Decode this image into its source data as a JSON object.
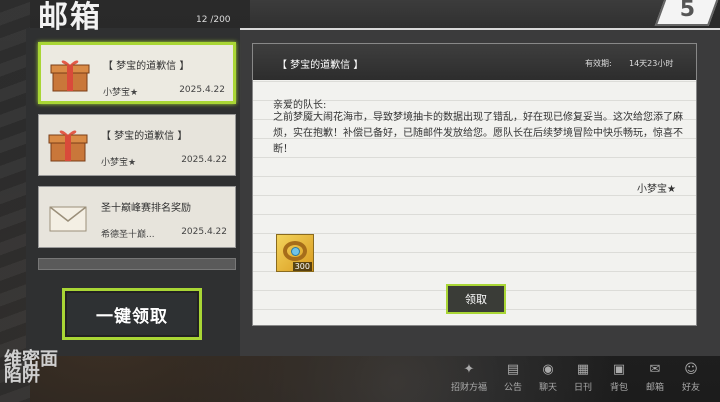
{
  "header": {
    "title": "邮箱",
    "count": "12 /200",
    "close_label": "5"
  },
  "mails": [
    {
      "subject": "【 梦宝的道歉信 】",
      "sender": "小梦宝★",
      "date": "2025.4.22",
      "active": true,
      "icon": "gift-box-icon"
    },
    {
      "subject": "【 梦宝的道歉信 】",
      "sender": "小梦宝★",
      "date": "2025.4.22",
      "active": false,
      "icon": "gift-box-icon"
    },
    {
      "subject": "圣十巅峰赛排名奖励",
      "sender": "希德圣十巅...",
      "date": "2025.4.22",
      "active": false,
      "icon": "envelope-icon"
    }
  ],
  "claim_all_label": "一键领取",
  "detail": {
    "subject": "【 梦宝的道歉信 】",
    "expiry_label": "有效期:",
    "expiry_value": "14天23小时",
    "greeting": "亲爱的队长:",
    "body": "之前梦魇大闹花海市，导致梦境抽卡的数据出现了错乱，好在现已修复妥当。这次给您添了麻烦，实在抱歉！补偿已备好，已随邮件发放给您。愿队长在后续梦境冒险中快乐畅玩，惊喜不断！",
    "signature": "小梦宝★",
    "attachment": {
      "icon": "ring-item-icon",
      "quantity": "300"
    },
    "claim_label": "领取"
  },
  "bottom_logo": "维密面\n陷阱",
  "nav": [
    {
      "label": "招财方福",
      "icon": "wealth-icon"
    },
    {
      "label": "公告",
      "icon": "announcement-icon"
    },
    {
      "label": "聊天",
      "icon": "chat-icon"
    },
    {
      "label": "日刊",
      "icon": "calendar-icon"
    },
    {
      "label": "背包",
      "icon": "bag-icon"
    },
    {
      "label": "邮箱",
      "icon": "mail-icon"
    },
    {
      "label": "好友",
      "icon": "friends-icon"
    }
  ],
  "colors": {
    "accent": "#a9d635",
    "panel": "#3b3b3c",
    "paper": "#f2f2ef"
  }
}
